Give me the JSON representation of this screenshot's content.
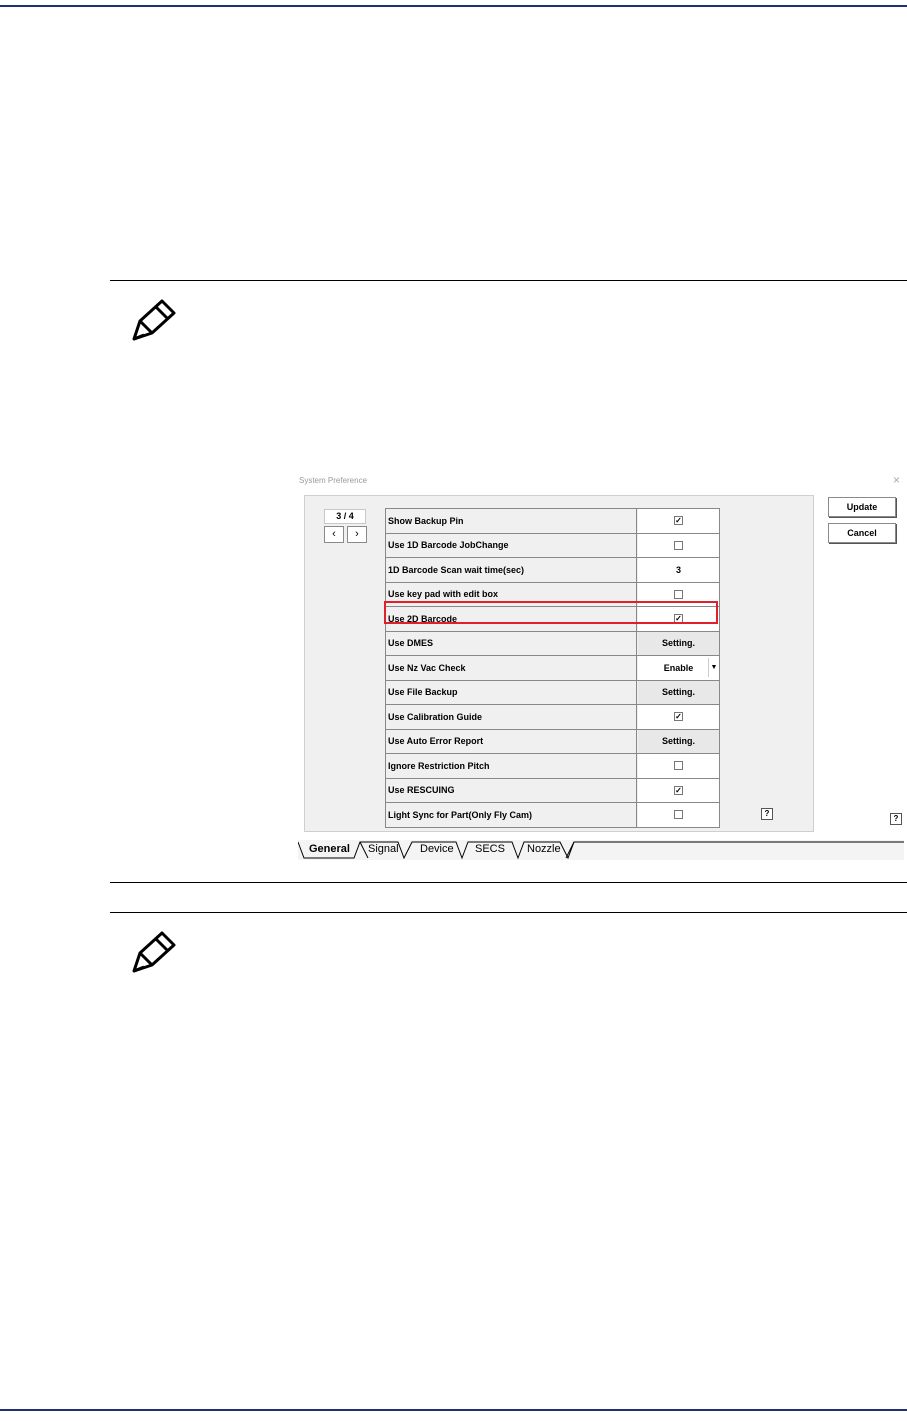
{
  "dialog": {
    "title": "System Preference",
    "close_glyph": "×",
    "page_indicator": "3 / 4",
    "prev_glyph": "‹",
    "next_glyph": "›",
    "update_label": "Update",
    "cancel_label": "Cancel",
    "help_glyph": "?",
    "rows": [
      {
        "label": "Show Backup Pin",
        "type": "checkbox",
        "checked": true
      },
      {
        "label": "Use 1D Barcode JobChange",
        "type": "checkbox",
        "checked": false
      },
      {
        "label": "1D Barcode Scan wait time(sec)",
        "type": "text",
        "value": "3"
      },
      {
        "label": "Use key pad with edit box",
        "type": "checkbox",
        "checked": false
      },
      {
        "label": "Use 2D Barcode",
        "type": "checkbox",
        "checked": true,
        "highlighted": true
      },
      {
        "label": "Use DMES",
        "type": "button",
        "value": "Setting."
      },
      {
        "label": "Use Nz Vac Check",
        "type": "combo",
        "value": "Enable"
      },
      {
        "label": "Use File Backup",
        "type": "button",
        "value": "Setting."
      },
      {
        "label": "Use Calibration Guide",
        "type": "checkbox",
        "checked": true
      },
      {
        "label": "Use Auto Error Report",
        "type": "button",
        "value": "Setting."
      },
      {
        "label": "Ignore Restriction Pitch",
        "type": "checkbox",
        "checked": false
      },
      {
        "label": "Use RESCUING",
        "type": "checkbox",
        "checked": true
      },
      {
        "label": "Light Sync for Part(Only Fly Cam)",
        "type": "checkbox",
        "checked": false
      }
    ],
    "tabs": [
      "General",
      "Signal",
      "Device",
      "SECS",
      "Nozzle"
    ],
    "active_tab": "General"
  },
  "colors": {
    "page_rule": "#1f2f7a",
    "highlight": "#e0202a"
  }
}
